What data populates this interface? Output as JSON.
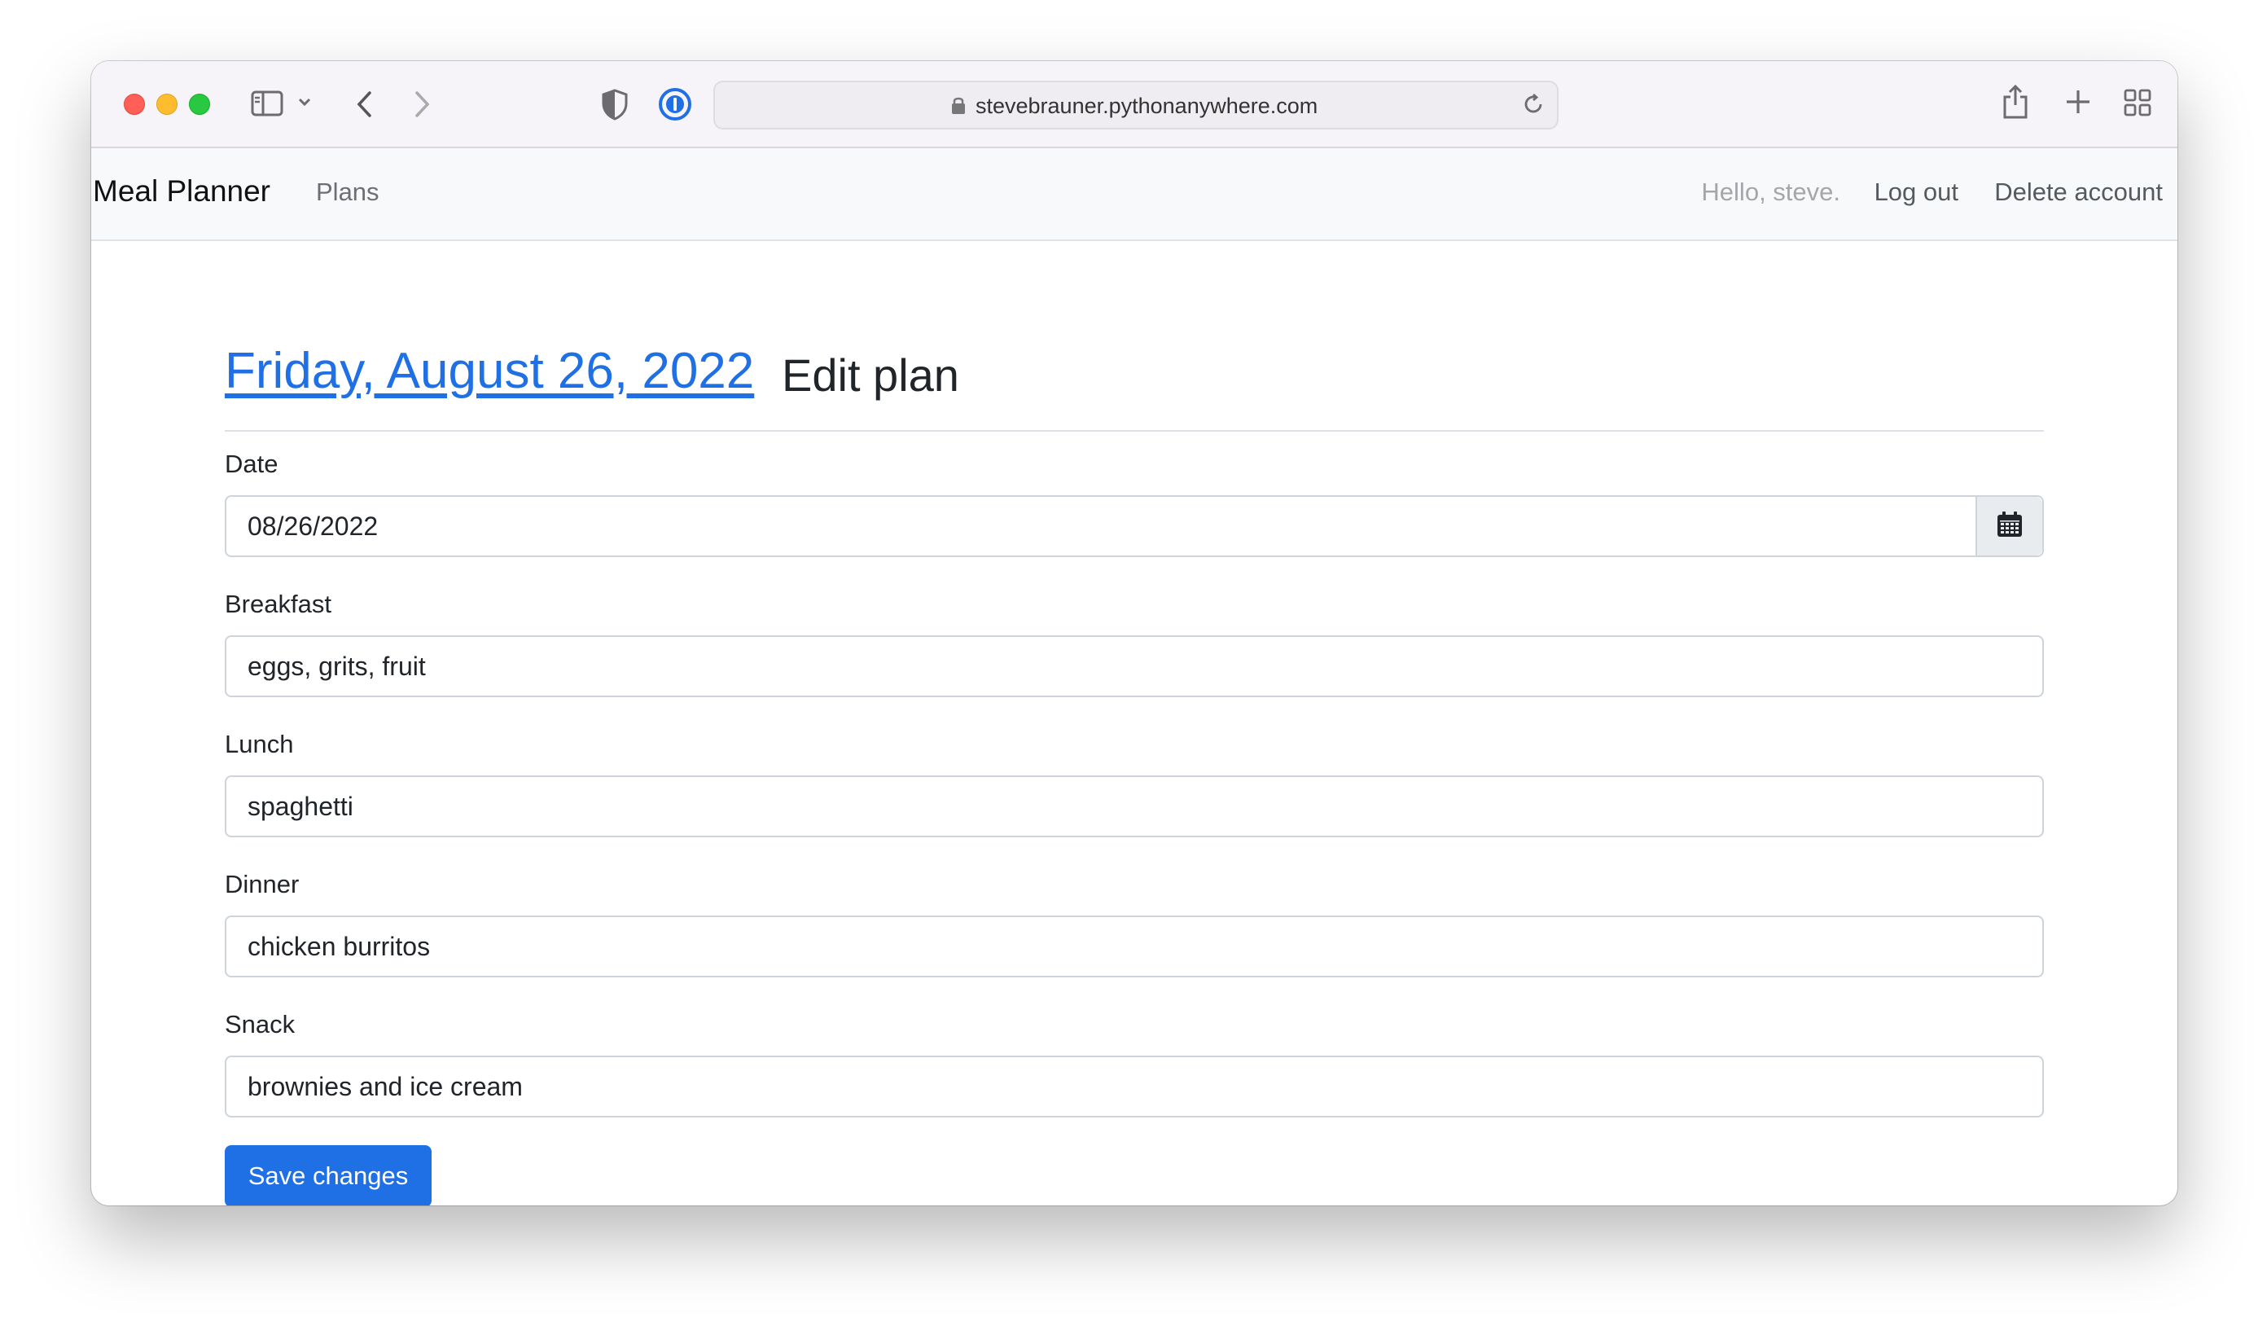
{
  "browser": {
    "url": "stevebrauner.pythonanywhere.com",
    "icons": [
      "sidebar-icon",
      "chevron-down-icon",
      "back-icon",
      "forward-icon",
      "shield-icon",
      "password-manager-icon",
      "lock-icon",
      "reload-icon",
      "share-icon",
      "new-tab-icon",
      "tab-overview-icon"
    ]
  },
  "navbar": {
    "brand": "Meal Planner",
    "plans": "Plans",
    "greeting": "Hello, steve.",
    "logout": "Log out",
    "delete": "Delete account"
  },
  "page": {
    "date_link": "Friday, August 26, 2022",
    "heading": "Edit plan"
  },
  "form": {
    "date": {
      "label": "Date",
      "value": "08/26/2022"
    },
    "breakfast": {
      "label": "Breakfast",
      "value": "eggs, grits, fruit"
    },
    "lunch": {
      "label": "Lunch",
      "value": "spaghetti"
    },
    "dinner": {
      "label": "Dinner",
      "value": "chicken burritos"
    },
    "snack": {
      "label": "Snack",
      "value": "brownies and ice cream"
    },
    "submit": "Save changes"
  },
  "colors": {
    "primary": "#1f6fe5",
    "navbar_bg": "#f8f9fa"
  }
}
